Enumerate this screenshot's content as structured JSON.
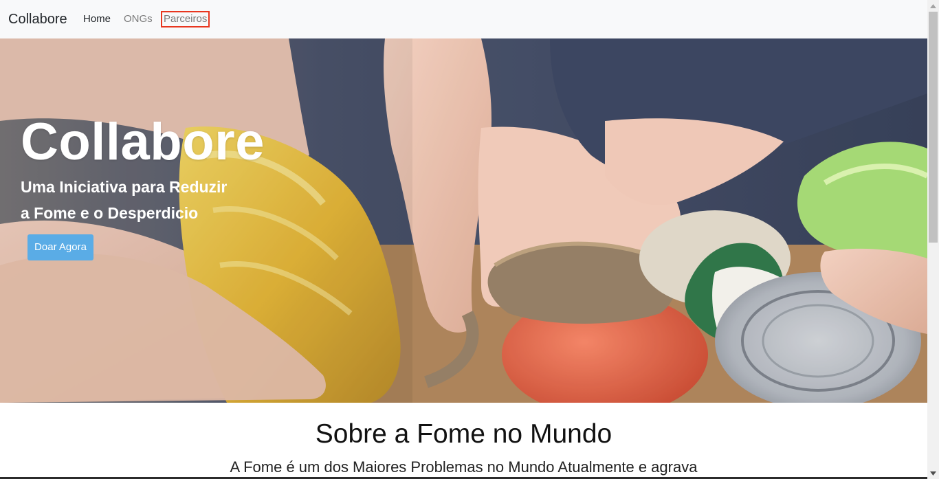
{
  "navbar": {
    "brand": "Collabore",
    "links": [
      {
        "label": "Home",
        "state": "active"
      },
      {
        "label": "ONGs",
        "state": "inactive"
      },
      {
        "label": "Parceiros",
        "state": "highlighted"
      }
    ]
  },
  "hero": {
    "title": "Collabore",
    "subtitle_line1": "Uma Iniciativa para Reduzir",
    "subtitle_line2": "a Fome e o Desperdicio",
    "cta_label": "Doar Agora"
  },
  "section": {
    "title": "Sobre a Fome no Mundo",
    "text": "A Fome é um dos Maiores Problemas no Mundo Atualmente e agrava"
  },
  "colors": {
    "navbar_bg": "#f8f9fa",
    "cta_bg": "#5aace6",
    "highlight_border": "#e8361f"
  },
  "icons": {
    "scroll_up": "chevron-up-icon",
    "scroll_down": "chevron-down-icon"
  }
}
